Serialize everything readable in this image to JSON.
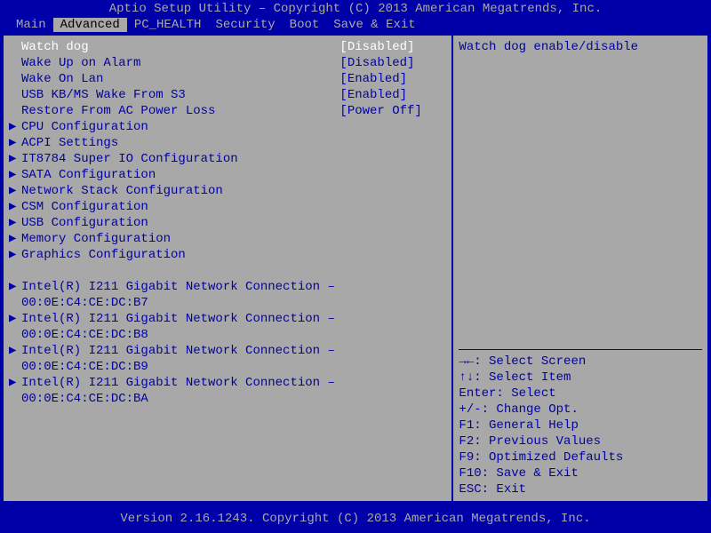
{
  "title": "Aptio Setup Utility – Copyright (C) 2013 American Megatrends, Inc.",
  "tabs": [
    {
      "label": "Main"
    },
    {
      "label": "Advanced"
    },
    {
      "label": "PC_HEALTH"
    },
    {
      "label": "Security"
    },
    {
      "label": "Boot"
    },
    {
      "label": "Save & Exit"
    }
  ],
  "activeTab": 1,
  "options": [
    {
      "label": "Watch dog",
      "value": "[Disabled]",
      "selected": true
    },
    {
      "label": "Wake Up on Alarm",
      "value": "[Disabled]"
    },
    {
      "label": "Wake On Lan",
      "value": "[Enabled]"
    },
    {
      "label": "USB KB/MS Wake From S3",
      "value": "[Enabled]"
    },
    {
      "label": "Restore From AC Power Loss",
      "value": "[Power Off]"
    }
  ],
  "submenus": [
    {
      "label": "CPU Configuration"
    },
    {
      "label": "ACPI Settings"
    },
    {
      "label": "IT8784 Super IO Configuration"
    },
    {
      "label": "SATA Configuration"
    },
    {
      "label": "Network Stack Configuration"
    },
    {
      "label": "CSM Configuration"
    },
    {
      "label": "USB Configuration"
    },
    {
      "label": "Memory Configuration"
    },
    {
      "label": "Graphics Configuration"
    }
  ],
  "network_entries": [
    {
      "line1": "Intel(R) I211 Gigabit  Network Connection –",
      "line2": "00:0E:C4:CE:DC:B7"
    },
    {
      "line1": "Intel(R) I211 Gigabit  Network Connection –",
      "line2": "00:0E:C4:CE:DC:B8"
    },
    {
      "line1": "Intel(R) I211 Gigabit  Network Connection –",
      "line2": "00:0E:C4:CE:DC:B9"
    },
    {
      "line1": "Intel(R) I211 Gigabit  Network Connection –",
      "line2": "00:0E:C4:CE:DC:BA"
    }
  ],
  "help": {
    "description": "Watch dog enable/disable",
    "nav": [
      "→←: Select Screen",
      "↑↓: Select Item",
      "Enter: Select",
      "+/-: Change Opt.",
      "F1: General Help",
      "F2: Previous Values",
      "F9: Optimized Defaults",
      "F10: Save & Exit",
      "ESC: Exit"
    ]
  },
  "arrow": "▶",
  "footer": "Version 2.16.1243. Copyright (C) 2013 American Megatrends, Inc."
}
